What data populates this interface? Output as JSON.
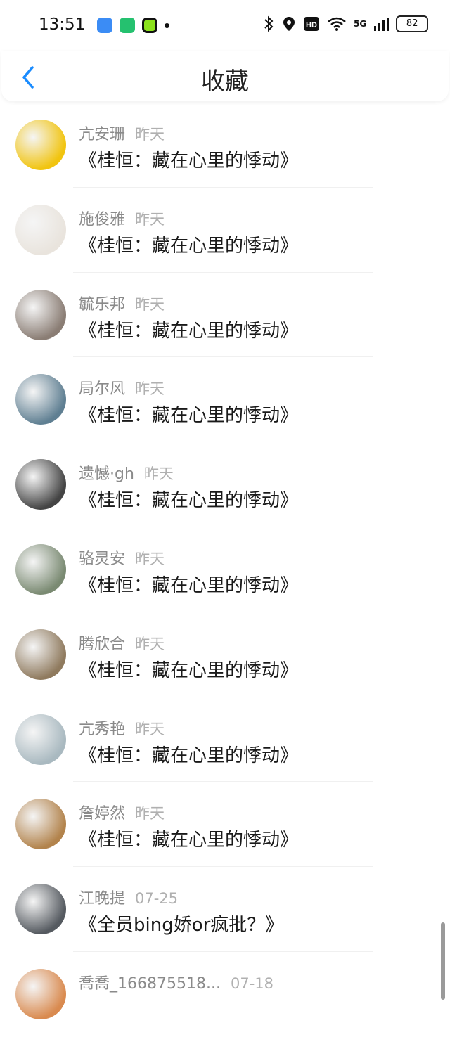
{
  "status": {
    "time": "13:51",
    "network": "5G",
    "battery": "82"
  },
  "header": {
    "title": "收藏",
    "back_icon": "chevron-left-icon",
    "accent": "#1a8cff"
  },
  "items": [
    {
      "user": "亢安珊",
      "date": "昨天",
      "work": "《桂恒：藏在心里的悸动》",
      "avatar_color": "#f1c40f"
    },
    {
      "user": "施俊雅",
      "date": "昨天",
      "work": "《桂恒：藏在心里的悸动》",
      "avatar_color": "#e9e4dd"
    },
    {
      "user": "毓乐邦",
      "date": "昨天",
      "work": "《桂恒：藏在心里的悸动》",
      "avatar_color": "#8a7d74"
    },
    {
      "user": "局尔风",
      "date": "昨天",
      "work": "《桂恒：藏在心里的悸动》",
      "avatar_color": "#5f7f92"
    },
    {
      "user": "遗憾·gh",
      "date": "昨天",
      "work": "《桂恒：藏在心里的悸动》",
      "avatar_color": "#444444"
    },
    {
      "user": "骆灵安",
      "date": "昨天",
      "work": "《桂恒：藏在心里的悸动》",
      "avatar_color": "#7a8a72"
    },
    {
      "user": "腾欣合",
      "date": "昨天",
      "work": "《桂恒：藏在心里的悸动》",
      "avatar_color": "#8f7a5e"
    },
    {
      "user": "亢秀艳",
      "date": "昨天",
      "work": "《桂恒：藏在心里的悸动》",
      "avatar_color": "#a9b9c0"
    },
    {
      "user": "詹婷然",
      "date": "昨天",
      "work": "《桂恒：藏在心里的悸动》",
      "avatar_color": "#b2834c"
    },
    {
      "user": "江晚提",
      "date": "07-25",
      "work": "《全员bing娇or疯批？》",
      "avatar_color": "#555a60"
    },
    {
      "user": "喬喬_166875518...",
      "date": "07-18",
      "work": "",
      "avatar_color": "#d98a4f"
    }
  ]
}
